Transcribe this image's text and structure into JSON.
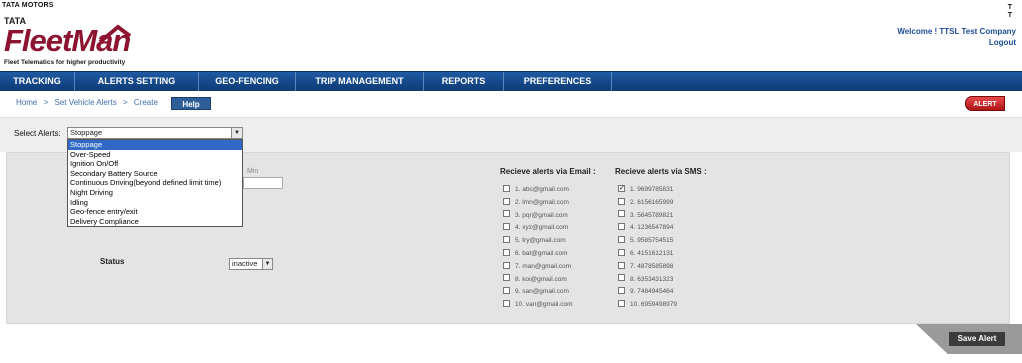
{
  "header": {
    "brand_top": "TATA MOTORS",
    "logo_tata": "TATA",
    "logo_main": "FleetMan",
    "logo_tagline": "Fleet Telematics for higher productivity",
    "welcome": "Welcome ! TTSL Test Company",
    "logout": "Logout",
    "corner_mark": "T"
  },
  "nav": {
    "items": [
      {
        "label": "TRACKING"
      },
      {
        "label": "ALERTS SETTING"
      },
      {
        "label": "GEO-FENCING"
      },
      {
        "label": "TRIP MANAGEMENT"
      },
      {
        "label": "REPORTS"
      },
      {
        "label": "PREFERENCES"
      }
    ]
  },
  "breadcrumb": {
    "home": "Home",
    "sep": ">",
    "set_vehicle_alerts": "Set Vehicle Alerts",
    "create": "Create",
    "help": "Help"
  },
  "alert_button": "ALERT",
  "select_alerts": {
    "label": "Select Alerts:",
    "value": "Stoppage",
    "options": [
      "Stoppage",
      "Over-Speed",
      "Ignition On/Off",
      "Secondary Battery Source",
      "Continuous Driving(beyond defined limit time)",
      "Night Driving",
      "Idling",
      "Geo-fence entry/exit",
      "Delivery Compliance"
    ],
    "highlighted_index": 0
  },
  "min_label": "Min",
  "status": {
    "label": "Status",
    "value": "inactive"
  },
  "email_alerts": {
    "heading": "Recieve alerts via Email :",
    "items": [
      {
        "text": "1. abc@gmail.com",
        "checked": false
      },
      {
        "text": "2. lmn@gmail.com",
        "checked": false
      },
      {
        "text": "3. pqr@gmail.com",
        "checked": false
      },
      {
        "text": "4. xyz@gmail.com",
        "checked": false
      },
      {
        "text": "5. try@gmail.com",
        "checked": false
      },
      {
        "text": "6. bat@gmail.com",
        "checked": false
      },
      {
        "text": "7. man@gmail.com",
        "checked": false
      },
      {
        "text": "8. koi@gmail.com",
        "checked": false
      },
      {
        "text": "9. san@gmail.com",
        "checked": false
      },
      {
        "text": "10. van@gmail.com",
        "checked": false
      }
    ]
  },
  "sms_alerts": {
    "heading": "Recieve alerts via SMS :",
    "items": [
      {
        "text": "1. 9699785831",
        "checked": true
      },
      {
        "text": "2. 6156165999",
        "checked": false
      },
      {
        "text": "3. 5645789821",
        "checked": false
      },
      {
        "text": "4. 1236547894",
        "checked": false
      },
      {
        "text": "5. 9585754515",
        "checked": false
      },
      {
        "text": "6. 4151612131",
        "checked": false
      },
      {
        "text": "7. 4878585898",
        "checked": false
      },
      {
        "text": "8. 6353431323",
        "checked": false
      },
      {
        "text": "9. 7484945464",
        "checked": false
      },
      {
        "text": "10. 6959498979",
        "checked": false
      }
    ]
  },
  "save_button": "Save Alert",
  "colors": {
    "nav_blue": "#0d3a75",
    "brand_red": "#8c1430",
    "link_blue": "#3d6fab",
    "highlight": "#3169c6"
  }
}
